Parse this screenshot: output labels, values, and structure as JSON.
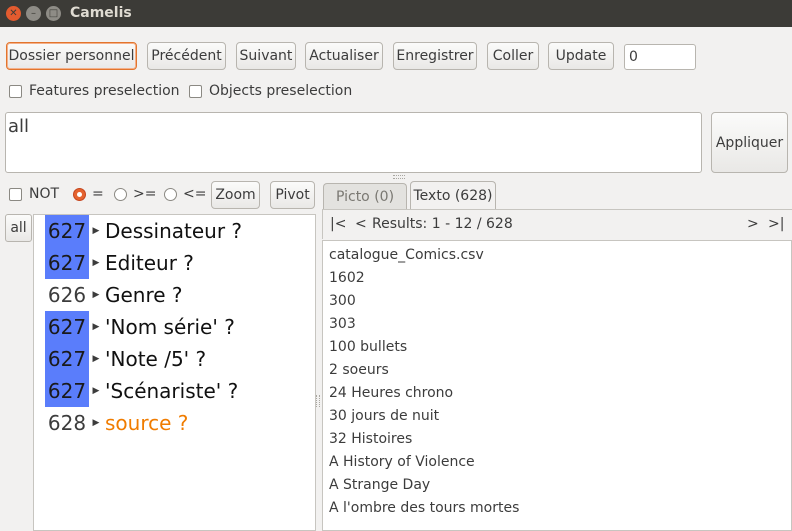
{
  "window": {
    "title": "Camelis"
  },
  "toolbar": {
    "buttons": [
      "Dossier personnel",
      "Précédent",
      "Suivant",
      "Actualiser",
      "Enregistrer",
      "Coller",
      "Update"
    ],
    "counter_value": "0"
  },
  "preselection": {
    "features_label": "Features preselection",
    "objects_label": "Objects preselection"
  },
  "query": {
    "text": "all",
    "apply_label": "Appliquer"
  },
  "filter": {
    "not_label": "NOT",
    "eq_label": "=",
    "ge_label": ">=",
    "le_label": "<=",
    "zoom_label": "Zoom",
    "pivot_label": "Pivot",
    "selected_operator": "="
  },
  "tabs": {
    "picto": "Picto (0)",
    "texto": "Texto (628)",
    "active": "Texto (628)"
  },
  "features": {
    "root_label": "all",
    "items": [
      {
        "count": "627",
        "label": "Dessinateur ?",
        "selected": true
      },
      {
        "count": "627",
        "label": "Editeur ?",
        "selected": true
      },
      {
        "count": "626",
        "label": "Genre ?",
        "selected": false
      },
      {
        "count": "627",
        "label": "'Nom série' ?",
        "selected": true
      },
      {
        "count": "627",
        "label": "'Note /5' ?",
        "selected": true
      },
      {
        "count": "627",
        "label": "'Scénariste' ?",
        "selected": true
      },
      {
        "count": "628",
        "label": "source ?",
        "selected": false,
        "highlight": true
      }
    ]
  },
  "results": {
    "first": "|<",
    "prev": "<",
    "summary": "Results: 1 - 12 / 628",
    "next": ">",
    "last": ">|",
    "items": [
      "catalogue_Comics.csv",
      "1602",
      "300",
      "303",
      "100 bullets",
      "2 soeurs",
      "24 Heures chrono",
      "30 jours de nuit",
      "32 Histoires",
      "A History of Violence",
      "A Strange Day",
      "A l'ombre des tours mortes"
    ]
  },
  "colors": {
    "selected_count_bg": "#5a7dfb",
    "highlight_feature": "#f07c00",
    "titlebar": "#3c3b37",
    "focus_border": "#e2752d"
  }
}
